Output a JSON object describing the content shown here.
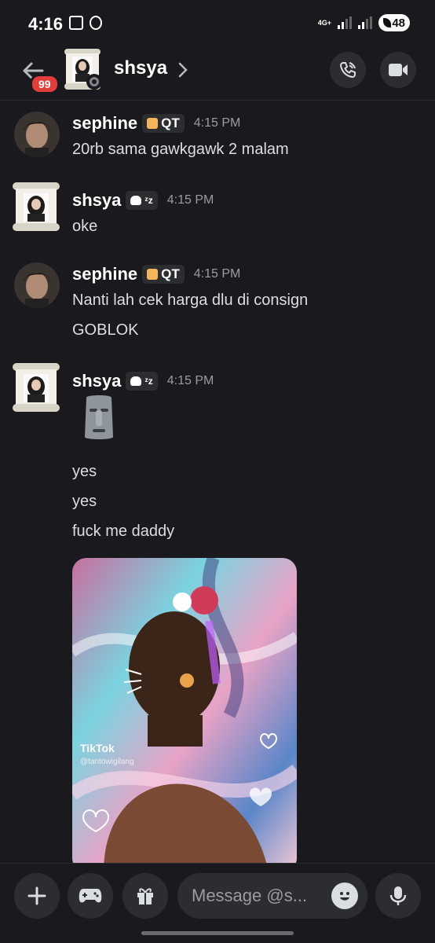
{
  "status_bar": {
    "time": "4:16",
    "network": "4G+",
    "battery": "48"
  },
  "header": {
    "title": "shsya",
    "unread_count": "99"
  },
  "messages": [
    {
      "username": "sephine",
      "tag": "QT",
      "time": "4:15 PM",
      "lines": [
        "20rb sama gawkgawk 2 malam"
      ]
    },
    {
      "username": "shsya",
      "tag": "ᶻz",
      "time": "4:15 PM",
      "lines": [
        "oke"
      ]
    },
    {
      "username": "sephine",
      "tag": "QT",
      "time": "4:15 PM",
      "lines": [
        "Nanti lah cek harga dlu di consign",
        "GOBLOK"
      ]
    },
    {
      "username": "shsya",
      "tag": "ᶻz",
      "time": "4:15 PM",
      "lines": [
        "yes",
        "yes",
        "fuck me daddy"
      ],
      "media": {
        "watermark": "TikTok",
        "watermark_user": "@tantowigilang"
      }
    }
  ],
  "composer": {
    "placeholder": "Message @s..."
  },
  "icons": {
    "back": "arrow-left-icon",
    "call": "phone-icon",
    "video": "video-camera-icon",
    "plus": "plus-icon",
    "games": "gamepad-icon",
    "gift": "gift-icon",
    "emoji": "smiley-icon",
    "mic": "microphone-icon",
    "moai": "moai-emoji"
  },
  "colors": {
    "background": "#1a1a1e",
    "surface": "#2b2d31",
    "badge": "#e23c3c",
    "timestamp": "#9a9ca3"
  }
}
